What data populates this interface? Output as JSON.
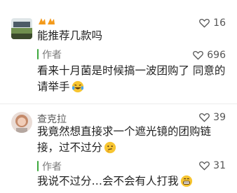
{
  "comments": [
    {
      "username": "",
      "likes": "16",
      "text": "能推荐几款吗",
      "reply": {
        "author": "作者",
        "likes": "696",
        "text_line1": "看来十月菌是时候搞一波团购了 同意的",
        "text_line2": "请举手",
        "emoji": "laughing-tears-emoji"
      }
    },
    {
      "username": "查克拉",
      "likes": "39",
      "text_line1": "我竟然想直接求一个遮光镜的团购链",
      "text_line2": "接，过不过分",
      "emoji": "thinking-emoji",
      "reply": {
        "author": "作者",
        "likes": "31",
        "text": "我说不过分…会不会有人打我",
        "emoji": "grin-emoji"
      }
    }
  ],
  "colors": {
    "accent": "#3ea83e",
    "text": "#222222",
    "muted": "#7a7a7a"
  }
}
